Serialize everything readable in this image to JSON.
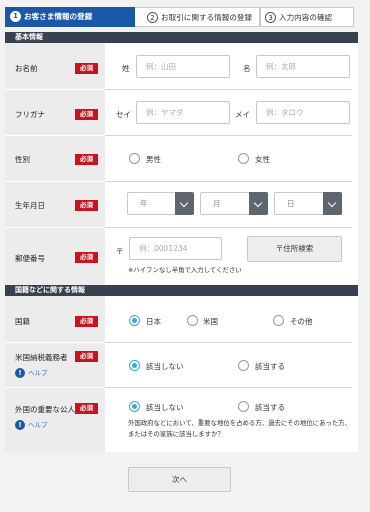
{
  "steps": [
    {
      "num": "1",
      "label": "お客さま情報の登録"
    },
    {
      "num": "2",
      "label": "お取引に関する情報の登録"
    },
    {
      "num": "3",
      "label": "入力内容の確認"
    }
  ],
  "sections": {
    "basic": "基本情報",
    "nationality": "国籍などに関する情報"
  },
  "required": "必須",
  "help": "ヘルプ",
  "name": {
    "label": "お名前",
    "last_label": "姓",
    "last_placeholder": "例：山田",
    "first_label": "名",
    "first_placeholder": "例：太郎"
  },
  "furigana": {
    "label": "フリガナ",
    "last_label": "セイ",
    "last_placeholder": "例：ヤマダ",
    "first_label": "メイ",
    "first_placeholder": "例：タロウ"
  },
  "gender": {
    "label": "性別",
    "options": [
      "男性",
      "女性"
    ]
  },
  "birthdate": {
    "label": "生年月日",
    "year": "年",
    "month": "月",
    "day": "日"
  },
  "postal": {
    "label": "郵便番号",
    "mark": "〒",
    "placeholder": "例：0001234",
    "search_button": "〒住所検索",
    "note": "※ハイフンなし半角で入力してください"
  },
  "nationality": {
    "label": "国籍",
    "options": [
      "日本",
      "米国",
      "その他"
    ],
    "selected": "日本"
  },
  "us_tax": {
    "label": "米国納税義務者",
    "options": [
      "該当しない",
      "該当する"
    ],
    "selected": "該当しない"
  },
  "pep": {
    "label": "外国の重要な公人",
    "options": [
      "該当しない",
      "該当する"
    ],
    "selected": "該当しない",
    "note": "外国政府などにおいて、重要な地位を占める方、過去にその地位にあった方、またはその家族に該当しますか？"
  },
  "next_button": "次へ",
  "colors": {
    "accent": "#1b58a8",
    "required": "#c8141e",
    "section_header": "#374250",
    "radio_selected": "#35a8d6"
  }
}
